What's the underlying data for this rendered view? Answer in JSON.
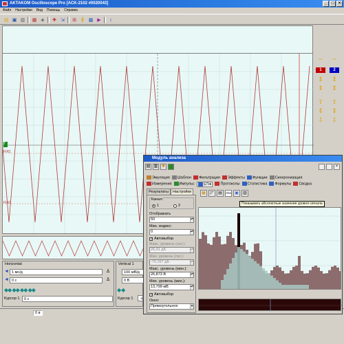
{
  "window": {
    "title": "AKTAKOM Oscilloscope Pro [ACK-2102 #0020043]",
    "controls": [
      "_",
      "□",
      "×"
    ]
  },
  "menu": [
    "Файл",
    "Настройки",
    "Вид",
    "Помощь",
    "Справка"
  ],
  "toolbar": {
    "icons": [
      "folder-icon",
      "save-icon",
      "print-icon",
      "copy-icon",
      "zoom-icon",
      "cursor-icon",
      "trigger-icon",
      "measure-icon",
      "settings-icon",
      "channel-icon",
      "run-icon",
      "stop-icon",
      "help-icon"
    ]
  },
  "scope": {
    "markers": {
      "ch1": "FIR1",
      "ch2": "FIR2",
      "trig": "T"
    },
    "trace_color": "#b03a3a",
    "bg_color": "#e8f8f6"
  },
  "right_panel": {
    "ch1_label": "1",
    "ch2_label": "2",
    "ch1_color": "#c00000",
    "ch2_color": "#0000c0"
  },
  "horizontal": {
    "title": "Horizontal",
    "scale": "1 мс/д",
    "offset": "0 с",
    "cursor_label": "Курсор 1",
    "cursor_value": "0 с"
  },
  "vertical": {
    "title": "Vertical 1",
    "scale": "100 мВ/д",
    "offset": "0 В",
    "cursor_label": "Курсор 1",
    "cursor_value": "-300"
  },
  "status": {
    "value": "0 в"
  },
  "analysis": {
    "title": "Модуль анализа",
    "tabs_row1": [
      "Эмуляция",
      "Шаблон",
      "Фильтрация",
      "Эффекты",
      "Функции",
      "Синхронизация"
    ],
    "tabs_row2": [
      "Измерения",
      "Импульс",
      "БПФ",
      "Протоколы",
      "Статистика",
      "Формулы",
      "Сводка"
    ],
    "subtabs": [
      "Результаты",
      "Настройки"
    ],
    "channel_label": "Канал:",
    "channel_options": [
      "1",
      "2"
    ],
    "display_label": "Отображать",
    "display_value": "50",
    "min_index_label": "Мин. индекс:",
    "min_index_value": "0",
    "autoselect_label": "Автовыбор",
    "max_level_dis_label": "Макс. уровень (лог.):",
    "max_level_dis_value": "26,91 дБ",
    "min_level_dis_label": "Мин. уровень (лог.):",
    "min_level_dis_value": "-75,167 дБ",
    "max_level_label": "Макс. уровень (мин.):",
    "max_level_value": "26,873 В",
    "min_level_label": "Мин. уровень (мин.):",
    "min_level_value": "13,799 мВ",
    "autoselect2_label": "Автовыбор",
    "window_label": "Окно:",
    "window_value": "Прямоугольное",
    "plot_tools": [
      "grid-icon",
      "line-icon",
      "bars-icon",
      "abs-toggle",
      "fill-icon",
      "export-icon"
    ],
    "abs_label": "Abs",
    "tooltip": "Показывать абсолютные значения уровня сигнала",
    "colors": {
      "bars": "#8c6c6c",
      "bars_light": "#a8c8c4",
      "peak": "#1a0000"
    }
  }
}
